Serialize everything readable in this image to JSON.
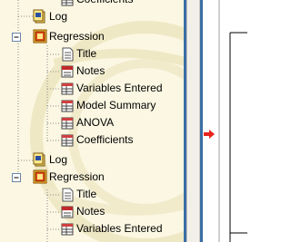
{
  "outline_tree": {
    "items": [
      {
        "label": "Coefficients",
        "icon": "table-icon"
      },
      {
        "label": "Log",
        "icon": "log-icon"
      },
      {
        "label": "Regression",
        "icon": "procedure-book-icon",
        "expanded": true
      },
      {
        "label": "Title",
        "icon": "title-page-icon"
      },
      {
        "label": "Notes",
        "icon": "notes-icon"
      },
      {
        "label": "Variables Entered",
        "icon": "table-icon"
      },
      {
        "label": "Model Summary",
        "icon": "table-icon"
      },
      {
        "label": "ANOVA",
        "icon": "table-icon"
      },
      {
        "label": "Coefficients",
        "icon": "table-icon"
      },
      {
        "label": "Log",
        "icon": "log-icon"
      },
      {
        "label": "Regression",
        "icon": "procedure-book-icon",
        "expanded": true
      },
      {
        "label": "Title",
        "icon": "title-page-icon"
      },
      {
        "label": "Notes",
        "icon": "notes-icon"
      },
      {
        "label": "Variables Entered",
        "icon": "table-icon"
      }
    ]
  },
  "output_pane": {
    "current_item_marker": "red-arrow-icon",
    "marker_color": "#e8231b"
  },
  "colors": {
    "pane_background": "#fbf7e2",
    "splitter_blue": "#3a6ea5",
    "expand_box_border": "#6b84ad"
  }
}
